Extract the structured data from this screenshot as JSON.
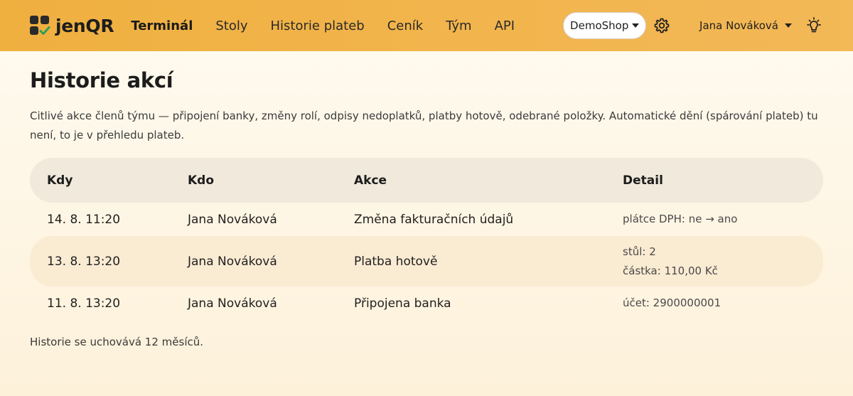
{
  "brand": {
    "name": "jenQR"
  },
  "nav": {
    "links": [
      {
        "label": "Terminál",
        "active": true
      },
      {
        "label": "Stoly",
        "active": false
      },
      {
        "label": "Historie plateb",
        "active": false
      },
      {
        "label": "Ceník",
        "active": false
      },
      {
        "label": "Tým",
        "active": false
      },
      {
        "label": "API",
        "active": false
      }
    ],
    "shop_selected": "DemoShop",
    "settings_icon": "gear-icon",
    "user_name": "Jana Nováková",
    "theme_icon": "lightbulb-icon"
  },
  "page": {
    "title": "Historie akcí",
    "description": "Citlivé akce členů týmu — připojení banky, změny rolí, odpisy nedoplatků, platby hotově, odebrané položky. Automatické dění (spárování plateb) tu není, to je v přehledu plateb.",
    "footnote": "Historie se uchovává 12 měsíců."
  },
  "table": {
    "headers": [
      "Kdy",
      "Kdo",
      "Akce",
      "Detail"
    ],
    "rows": [
      {
        "when": "14. 8. 11:20",
        "who": "Jana Nováková",
        "action": "Změna fakturačních údajů",
        "detail": [
          "plátce DPH: ne → ano"
        ]
      },
      {
        "when": "13. 8. 13:20",
        "who": "Jana Nováková",
        "action": "Platba hotově",
        "detail": [
          "stůl: 2",
          "částka: 110,00 Kč"
        ]
      },
      {
        "when": "11. 8. 13:20",
        "who": "Jana Nováková",
        "action": "Připojena banka",
        "detail": [
          "účet: 2900000001"
        ]
      }
    ]
  },
  "colors": {
    "navbar": "#f0b040",
    "row_highlight": "#faebd3",
    "header_row": "#f0e9dc",
    "logo_check": "#2e9e55"
  }
}
